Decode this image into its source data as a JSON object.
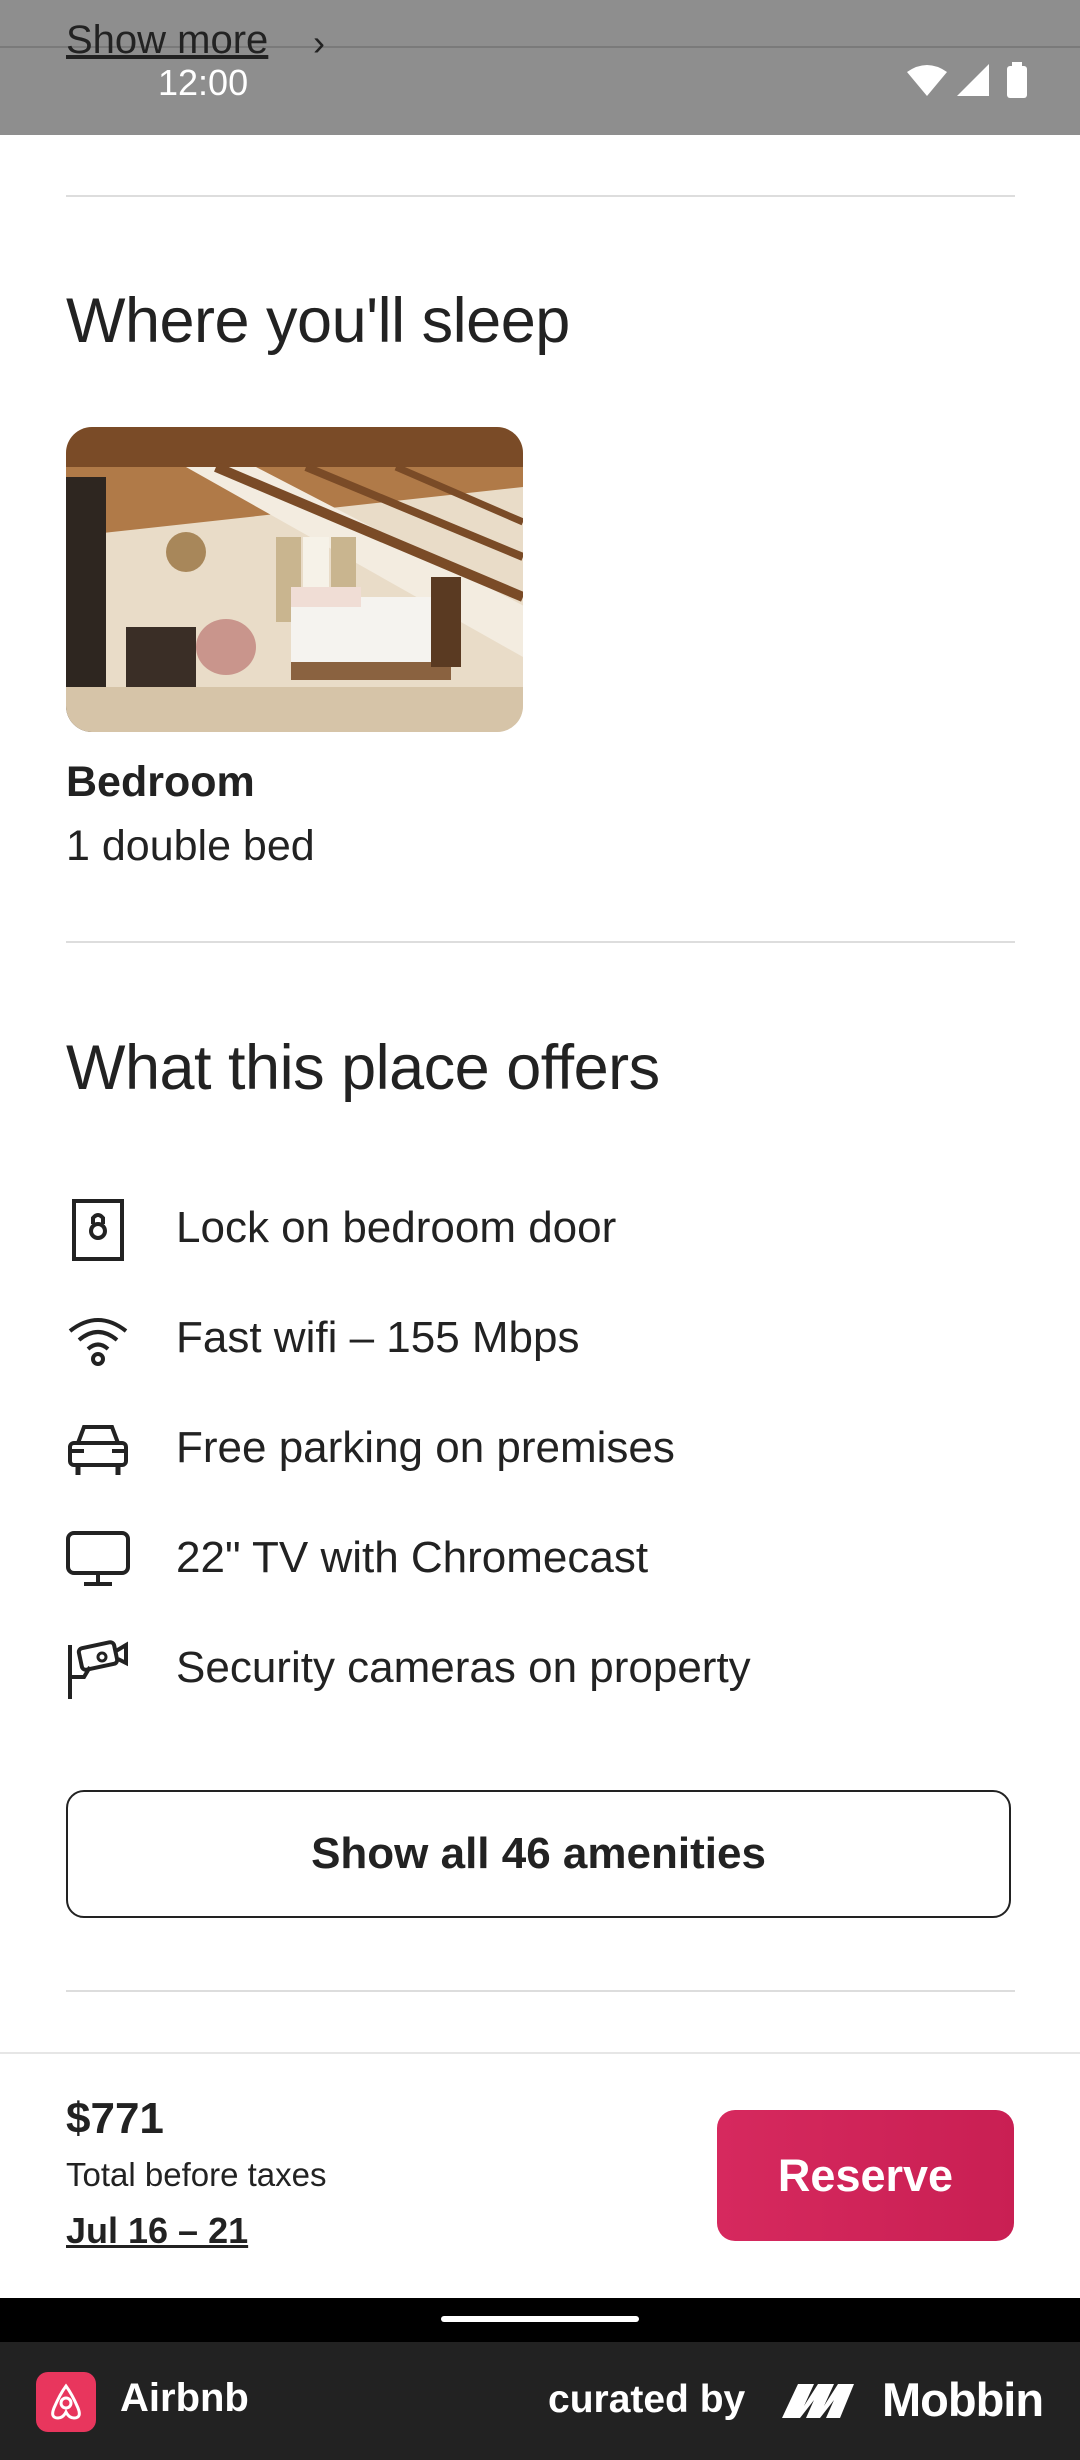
{
  "status_bar": {
    "peek_link": "Show more",
    "time": "12:00"
  },
  "sleep_section": {
    "title": "Where you'll sleep",
    "room": {
      "name": "Bedroom",
      "beds": "1 double bed"
    }
  },
  "amenities_section": {
    "title": "What this place offers",
    "items": [
      {
        "icon": "lock-icon",
        "label": "Lock on bedroom door"
      },
      {
        "icon": "wifi-icon",
        "label": "Fast wifi – 155 Mbps"
      },
      {
        "icon": "car-icon",
        "label": "Free parking on premises"
      },
      {
        "icon": "tv-icon",
        "label": "22\" TV with Chromecast"
      },
      {
        "icon": "security-camera-icon",
        "label": "Security cameras on property"
      }
    ],
    "show_all_label": "Show all 46 amenities"
  },
  "footer": {
    "price": "$771",
    "price_note": "Total before taxes",
    "dates": "Jul 16 – 21",
    "reserve_label": "Reserve"
  },
  "brand_bar": {
    "app_name": "Airbnb",
    "curated_label": "curated by",
    "curator_name": "Mobbin"
  },
  "colors": {
    "accent": "#d6295e",
    "text": "#222222",
    "divider": "#dddddd",
    "brand_bar": "#222222"
  }
}
